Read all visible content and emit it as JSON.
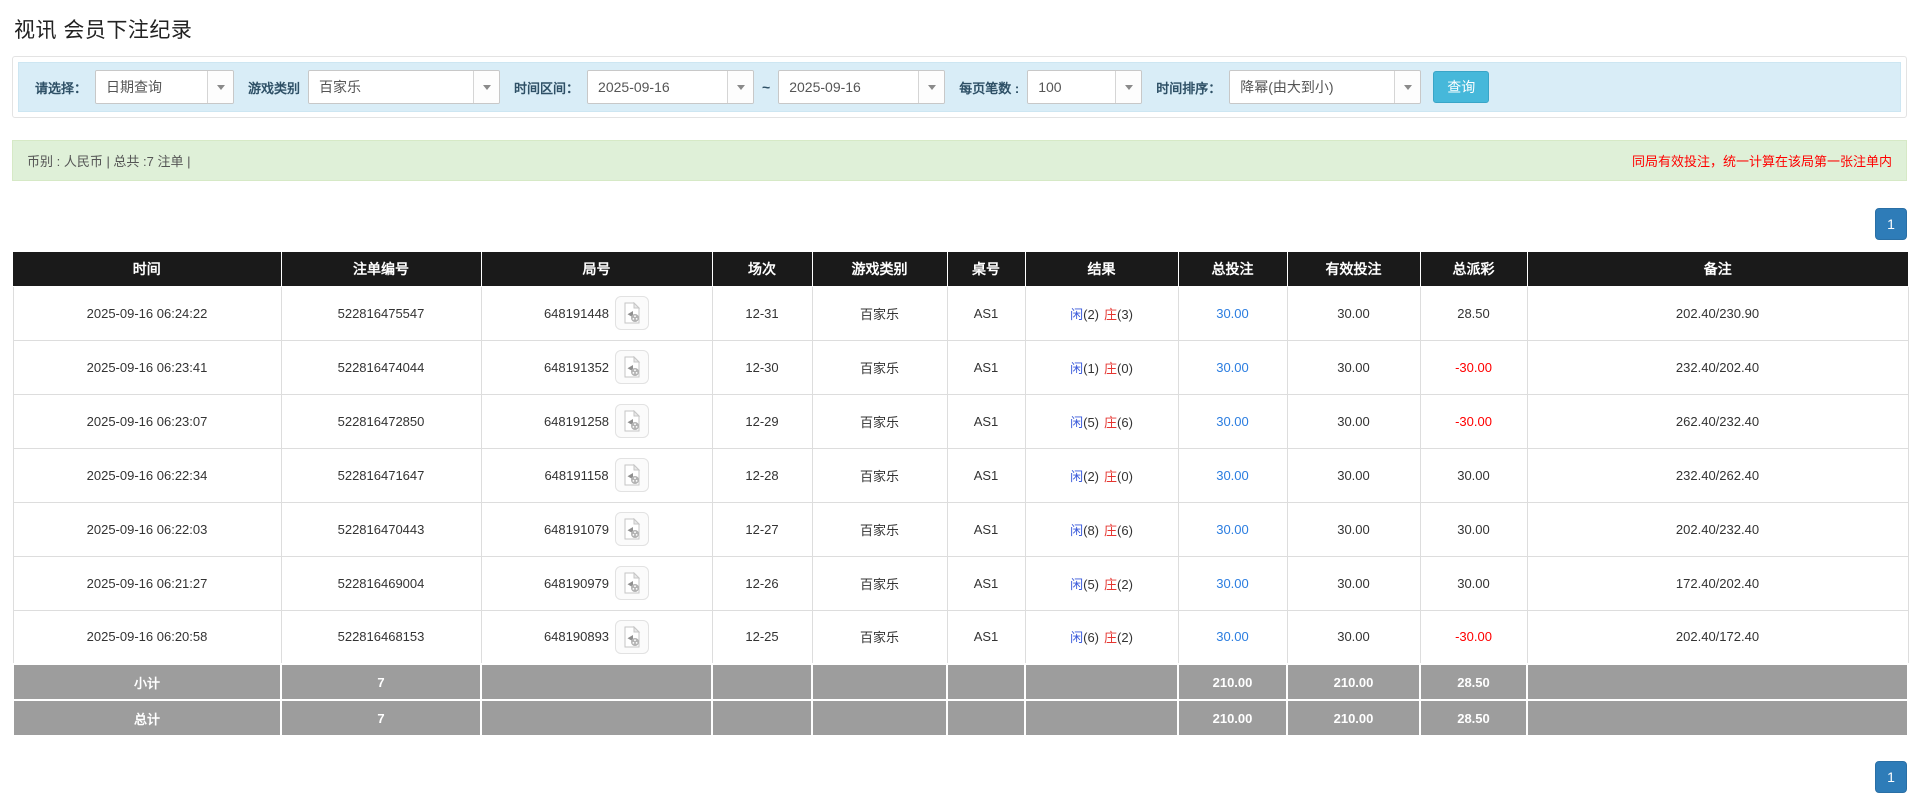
{
  "page": {
    "title": "视讯 会员下注纪录"
  },
  "filters": {
    "select_label": "请选择：",
    "select_value": "日期查询",
    "game_type_label": "游戏类别",
    "game_type_value": "百家乐",
    "time_range_label": "时间区间：",
    "date_from": "2025-09-16",
    "tilde": "~",
    "date_to": "2025-09-16",
    "page_size_label": "每页笔数 :",
    "page_size_value": "100",
    "sort_label": "时间排序：",
    "sort_value": "降幂(由大到小)",
    "search_button": "查询"
  },
  "summary": {
    "left": "币别 : 人民币 | 总共 :7 注单 |",
    "right_note": "同局有效投注，统一计算在该局第一张注单内"
  },
  "pagination": {
    "page": "1"
  },
  "colors": {
    "accent_blue": "#46b8da",
    "pager_blue": "#2e7cb8",
    "player_blue": "#3b5bdb",
    "banker_red": "#e53530",
    "negative_red": "#ff0000",
    "summary_green_bg": "#dff0d8",
    "filter_bar_bg": "#d9edf7",
    "header_black": "#1a1a1a",
    "footer_grey": "#9d9d9d"
  },
  "icons": {
    "dropdown_caret": "caret-down-icon",
    "round_video": "video-replay-icon"
  },
  "table": {
    "headers": [
      "时间",
      "注单编号",
      "局号",
      "场次",
      "游戏类别",
      "桌号",
      "结果",
      "总投注",
      "有效投注",
      "总派彩",
      "备注"
    ],
    "rows": [
      {
        "time": "2025-09-16 06:24:22",
        "bet_id": "522816475547",
        "round_id": "648191448",
        "session": "12-31",
        "game": "百家乐",
        "table_no": "AS1",
        "result_player": "闲",
        "result_player_n": "(2)",
        "result_banker": "庄",
        "result_banker_n": "(3)",
        "total_bet": "30.00",
        "valid_bet": "30.00",
        "payout": "28.50",
        "remark": "202.40/230.90"
      },
      {
        "time": "2025-09-16 06:23:41",
        "bet_id": "522816474044",
        "round_id": "648191352",
        "session": "12-30",
        "game": "百家乐",
        "table_no": "AS1",
        "result_player": "闲",
        "result_player_n": "(1)",
        "result_banker": "庄",
        "result_banker_n": "(0)",
        "total_bet": "30.00",
        "valid_bet": "30.00",
        "payout": "-30.00",
        "remark": "232.40/202.40"
      },
      {
        "time": "2025-09-16 06:23:07",
        "bet_id": "522816472850",
        "round_id": "648191258",
        "session": "12-29",
        "game": "百家乐",
        "table_no": "AS1",
        "result_player": "闲",
        "result_player_n": "(5)",
        "result_banker": "庄",
        "result_banker_n": "(6)",
        "total_bet": "30.00",
        "valid_bet": "30.00",
        "payout": "-30.00",
        "remark": "262.40/232.40"
      },
      {
        "time": "2025-09-16 06:22:34",
        "bet_id": "522816471647",
        "round_id": "648191158",
        "session": "12-28",
        "game": "百家乐",
        "table_no": "AS1",
        "result_player": "闲",
        "result_player_n": "(2)",
        "result_banker": "庄",
        "result_banker_n": "(0)",
        "total_bet": "30.00",
        "valid_bet": "30.00",
        "payout": "30.00",
        "remark": "232.40/262.40"
      },
      {
        "time": "2025-09-16 06:22:03",
        "bet_id": "522816470443",
        "round_id": "648191079",
        "session": "12-27",
        "game": "百家乐",
        "table_no": "AS1",
        "result_player": "闲",
        "result_player_n": "(8)",
        "result_banker": "庄",
        "result_banker_n": "(6)",
        "total_bet": "30.00",
        "valid_bet": "30.00",
        "payout": "30.00",
        "remark": "202.40/232.40"
      },
      {
        "time": "2025-09-16 06:21:27",
        "bet_id": "522816469004",
        "round_id": "648190979",
        "session": "12-26",
        "game": "百家乐",
        "table_no": "AS1",
        "result_player": "闲",
        "result_player_n": "(5)",
        "result_banker": "庄",
        "result_banker_n": "(2)",
        "total_bet": "30.00",
        "valid_bet": "30.00",
        "payout": "30.00",
        "remark": "172.40/202.40"
      },
      {
        "time": "2025-09-16 06:20:58",
        "bet_id": "522816468153",
        "round_id": "648190893",
        "session": "12-25",
        "game": "百家乐",
        "table_no": "AS1",
        "result_player": "闲",
        "result_player_n": "(6)",
        "result_banker": "庄",
        "result_banker_n": "(2)",
        "total_bet": "30.00",
        "valid_bet": "30.00",
        "payout": "-30.00",
        "remark": "202.40/172.40"
      }
    ],
    "subtotal": {
      "label": "小计",
      "count": "7",
      "total_bet": "210.00",
      "valid_bet": "210.00",
      "payout": "28.50"
    },
    "total": {
      "label": "总计",
      "count": "7",
      "total_bet": "210.00",
      "valid_bet": "210.00",
      "payout": "28.50"
    }
  }
}
